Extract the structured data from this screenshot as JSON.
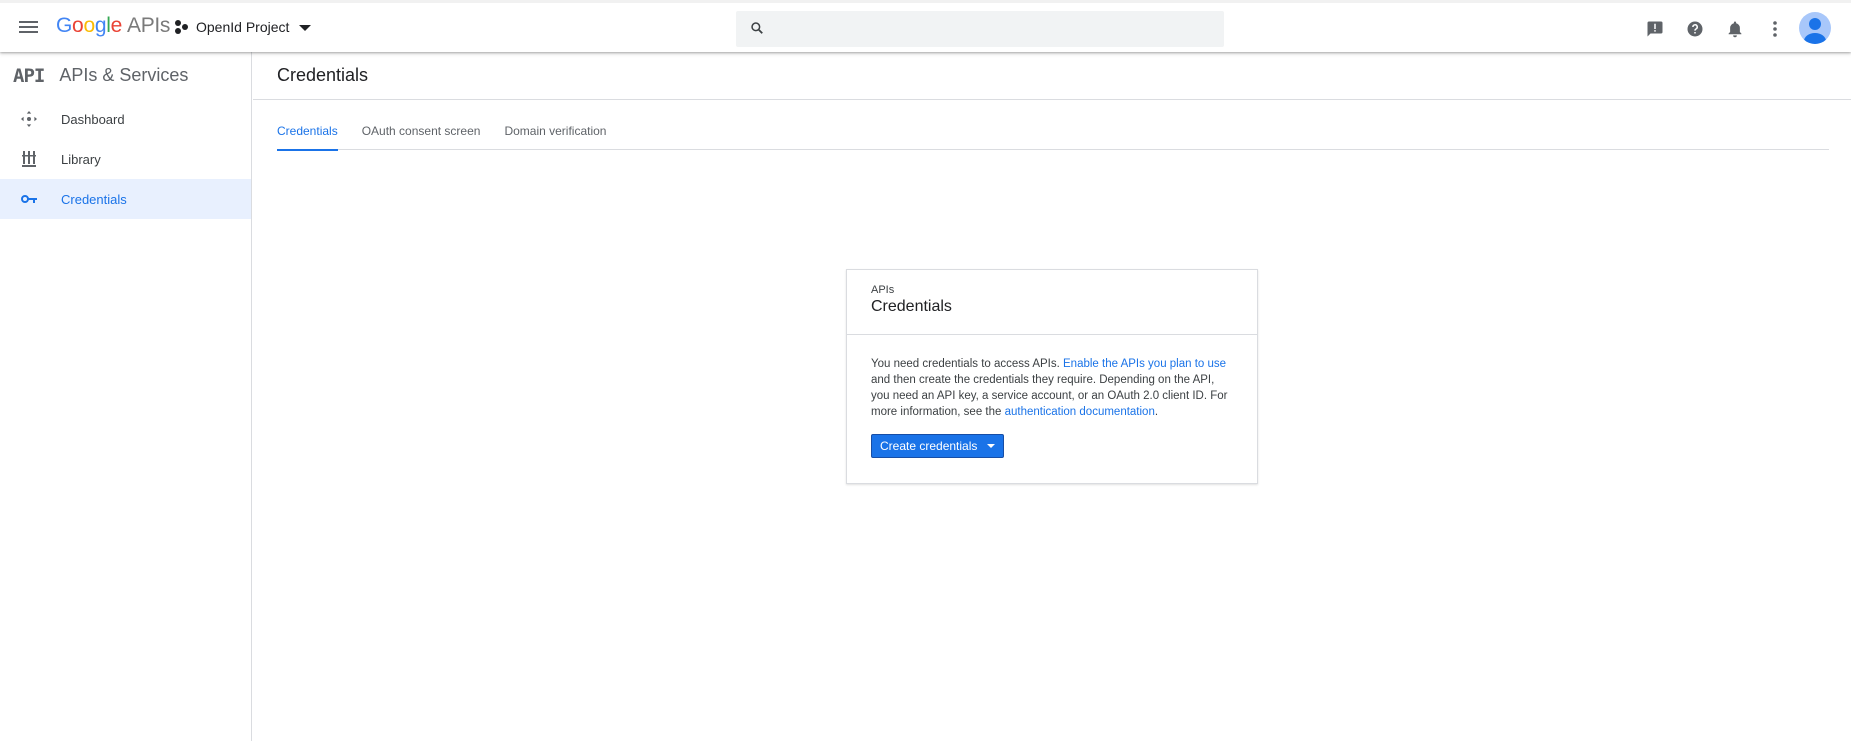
{
  "topbar": {
    "logo": {
      "g1": "G",
      "o1": "o",
      "o2": "o",
      "g2": "g",
      "l": "l",
      "e": "e",
      "apis": "APIs"
    },
    "project_name": "OpenId Project",
    "search_placeholder": "",
    "icons": [
      "feedback-icon",
      "help-icon",
      "notifications-icon",
      "more-vert-icon"
    ]
  },
  "sidebar": {
    "api_mark": "API",
    "title": "APIs & Services",
    "items": [
      {
        "label": "Dashboard",
        "icon": "dashboard-icon"
      },
      {
        "label": "Library",
        "icon": "library-icon"
      },
      {
        "label": "Credentials",
        "icon": "key-icon",
        "active": true
      }
    ]
  },
  "main": {
    "title": "Credentials",
    "tabs": [
      {
        "label": "Credentials",
        "active": true
      },
      {
        "label": "OAuth consent screen"
      },
      {
        "label": "Domain verification"
      }
    ]
  },
  "card": {
    "subtitle": "APIs",
    "title": "Credentials",
    "text1": "You need credentials to access APIs. ",
    "link1": "Enable the APIs you plan to use",
    "text2": " and then create the credentials they require. Depending on the API, you need an API key, a service account, or an OAuth 2.0 client ID. For more information, see the ",
    "link2": "authentication documentation",
    "text3": ".",
    "button": "Create credentials"
  },
  "colors": {
    "accent": "#1a73e8",
    "active_bg": "#e8f0fe"
  }
}
